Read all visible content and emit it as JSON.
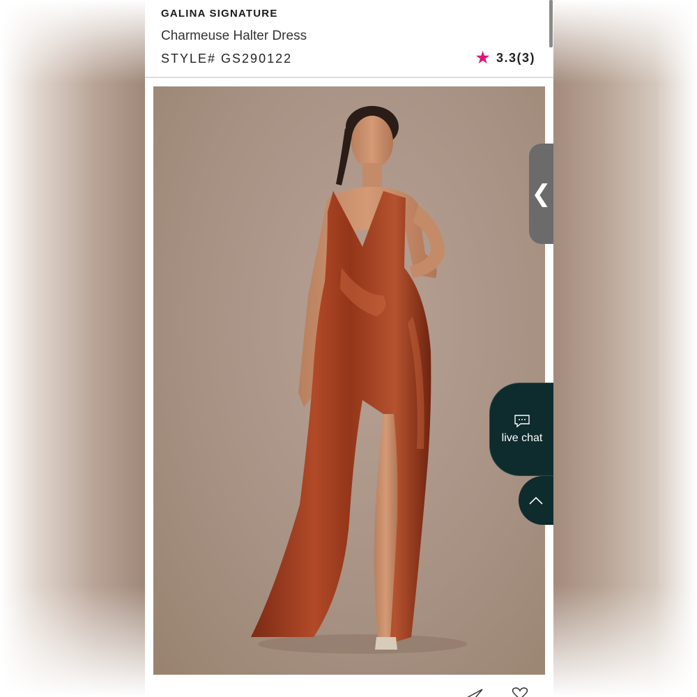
{
  "product": {
    "brand": "GALINA SIGNATURE",
    "title": "Charmeuse Halter Dress",
    "style": "STYLE# GS290122",
    "rating": "3.3(3)"
  },
  "chat": {
    "label": "live chat"
  },
  "icons": {
    "rating": "star-icon",
    "side_tab": "chevron-left-icon",
    "chat": "chat-bubble-icon",
    "back_to_top": "chevron-up-icon",
    "share": "share-icon",
    "favorite": "heart-icon"
  },
  "colors": {
    "star": "#e0147a",
    "chat_bg": "#0e2b2d",
    "dress": "#9b3a20",
    "photo_bg": "#a89284"
  }
}
